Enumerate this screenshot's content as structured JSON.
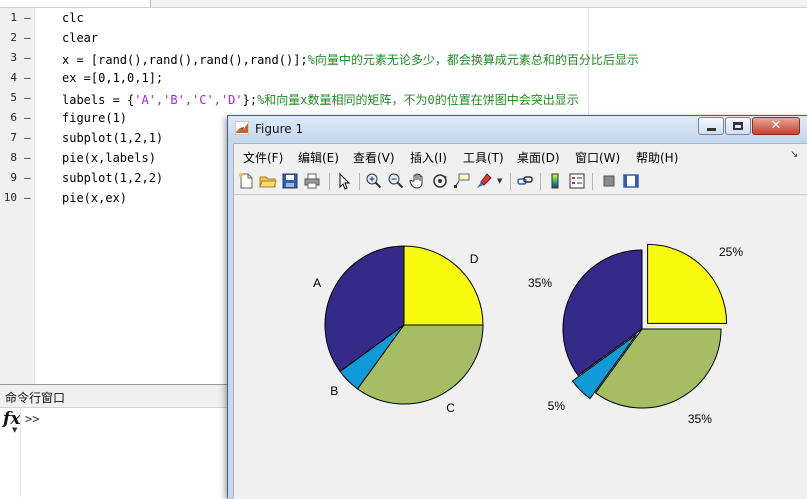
{
  "editor": {
    "lines": [
      {
        "num": "1",
        "dash": "—",
        "code": "clc",
        "str": "",
        "post": "",
        "comment": ""
      },
      {
        "num": "2",
        "dash": "—",
        "code": "clear",
        "str": "",
        "post": "",
        "comment": ""
      },
      {
        "num": "3",
        "dash": "—",
        "code": "x = [rand(),rand(),rand(),rand()];",
        "str": "",
        "post": "",
        "comment": "%向量中的元素无论多少，都会换算成元素总和的百分比后显示"
      },
      {
        "num": "4",
        "dash": "—",
        "code": "ex =[0,1,0,1];",
        "str": "",
        "post": "",
        "comment": ""
      },
      {
        "num": "5",
        "dash": "—",
        "code": "labels = {",
        "str": "'A','B','C','D'",
        "post": "};",
        "comment": "%和向量x数量相同的矩阵，不为0的位置在饼图中会突出显示"
      },
      {
        "num": "6",
        "dash": "—",
        "code": "figure(1)",
        "str": "",
        "post": "",
        "comment": ""
      },
      {
        "num": "7",
        "dash": "—",
        "code": "subplot(1,2,1)",
        "str": "",
        "post": "",
        "comment": ""
      },
      {
        "num": "8",
        "dash": "—",
        "code": "pie(x,labels)",
        "str": "",
        "post": "",
        "comment": ""
      },
      {
        "num": "9",
        "dash": "—",
        "code": "subplot(1,2,2)",
        "str": "",
        "post": "",
        "comment": ""
      },
      {
        "num": "10",
        "dash": "—",
        "code": "pie(x,ex)",
        "str": "",
        "post": "",
        "comment": ""
      }
    ]
  },
  "command_window": {
    "title": "命令行窗口",
    "fx": "fx",
    "prompt": ">>"
  },
  "figure": {
    "title": "Figure 1",
    "menus": [
      "文件(F)",
      "编辑(E)",
      "查看(V)",
      "插入(I)",
      "工具(T)",
      "桌面(D)",
      "窗口(W)",
      "帮助(H)"
    ],
    "close_glyph": "✕",
    "overflow_glyph": "↘"
  },
  "toolbar_icons": [
    "new-file-icon",
    "open-folder-icon",
    "save-icon",
    "print-icon",
    "pointer-icon",
    "zoom-in-icon",
    "zoom-out-icon",
    "pan-hand-icon",
    "rotate-3d-icon",
    "data-cursor-icon",
    "brush-icon",
    "link-plot-icon",
    "colorbar-icon",
    "legend-icon",
    "hide-plot-tools-icon",
    "show-plot-tools-icon"
  ],
  "chart_data": [
    {
      "type": "pie",
      "labels": [
        "A",
        "B",
        "C",
        "D"
      ],
      "values": [
        35,
        5,
        35,
        25
      ],
      "explode": [
        0,
        0,
        0,
        0
      ],
      "colors": [
        "#352a87",
        "#0f9bd7",
        "#a5be64",
        "#f9fb0e"
      ]
    },
    {
      "type": "pie",
      "labels": [
        "35%",
        "5%",
        "35%",
        "25%"
      ],
      "values": [
        35,
        5,
        35,
        25
      ],
      "explode": [
        0,
        1,
        0,
        1
      ],
      "colors": [
        "#352a87",
        "#0f9bd7",
        "#a5be64",
        "#f9fb0e"
      ]
    }
  ]
}
